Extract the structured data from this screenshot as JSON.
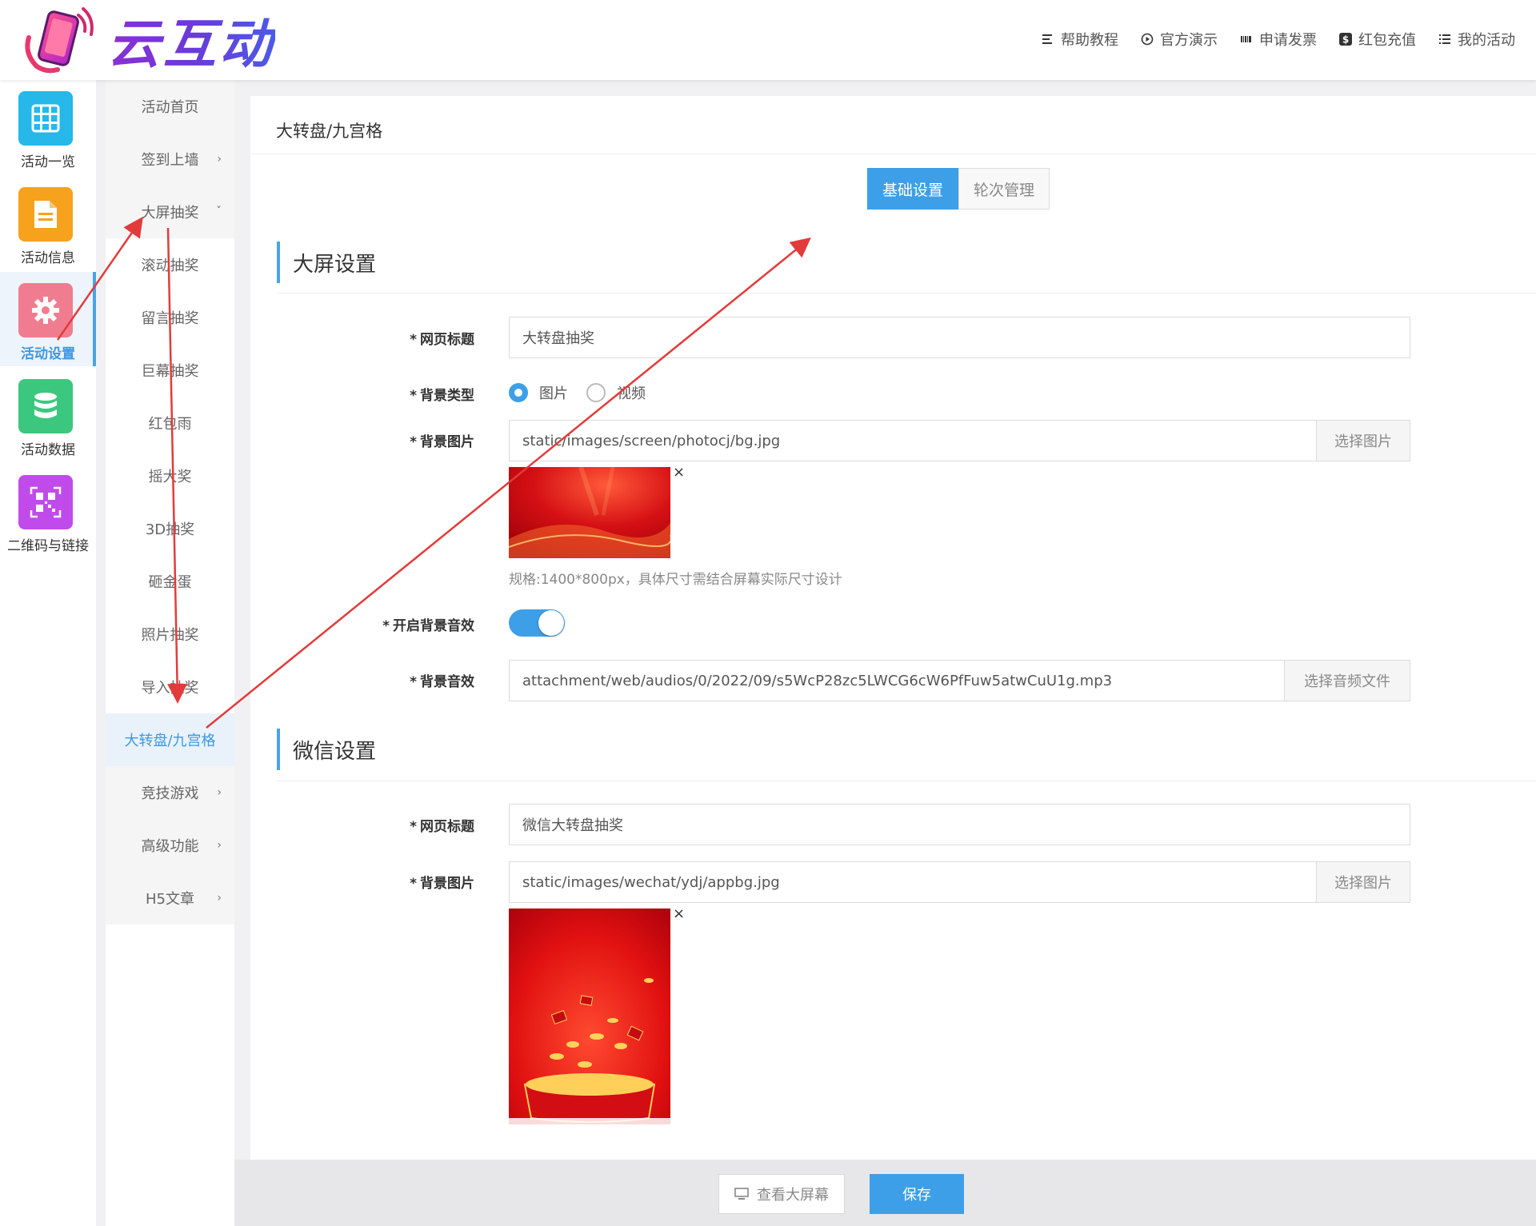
{
  "header": {
    "logo_text": "云互动",
    "nav": [
      {
        "icon": "list-icon",
        "label": "帮助教程"
      },
      {
        "icon": "play-circle-icon",
        "label": "官方演示"
      },
      {
        "icon": "barcode-icon",
        "label": "申请发票"
      },
      {
        "icon": "dollar-icon",
        "label": "红包充值"
      },
      {
        "icon": "menu-icon",
        "label": "我的活动"
      }
    ]
  },
  "rail": {
    "items": [
      {
        "label": "活动一览",
        "icon": "grid-icon",
        "color": "#25b8e8"
      },
      {
        "label": "活动信息",
        "icon": "document-icon",
        "color": "#f6a21d"
      },
      {
        "label": "活动设置",
        "icon": "gear-icon",
        "color": "#f07d8f"
      },
      {
        "label": "活动数据",
        "icon": "database-icon",
        "color": "#3cc77e"
      },
      {
        "label": "二维码与链接",
        "icon": "qrcode-icon",
        "color": "#c14bea"
      }
    ]
  },
  "subnav": {
    "items": [
      {
        "label": "活动首页"
      },
      {
        "label": "签到上墙"
      },
      {
        "label": "大屏抽奖"
      },
      {
        "label": "滚动抽奖"
      },
      {
        "label": "留言抽奖"
      },
      {
        "label": "巨幕抽奖"
      },
      {
        "label": "红包雨"
      },
      {
        "label": "摇大奖"
      },
      {
        "label": "3D抽奖"
      },
      {
        "label": "砸金蛋"
      },
      {
        "label": "照片抽奖"
      },
      {
        "label": "导入抽奖"
      },
      {
        "label": "大转盘/九宫格"
      },
      {
        "label": "竞技游戏"
      },
      {
        "label": "高级功能"
      },
      {
        "label": "H5文章"
      }
    ]
  },
  "main": {
    "title": "大转盘/九宫格",
    "tabs": [
      "基础设置",
      "轮次管理"
    ],
    "screen_section": {
      "title": "大屏设置",
      "page_title_label": "网页标题",
      "page_title_value": "大转盘抽奖",
      "bg_type_label": "背景类型",
      "bg_type_options": [
        "图片",
        "视频"
      ],
      "bg_image_label": "背景图片",
      "bg_image_value": "static/images/screen/photocj/bg.jpg",
      "choose_image": "选择图片",
      "spec_hint": "规格:1400*800px，具体尺寸需结合屏幕实际尺寸设计",
      "bg_sound_toggle_label": "开启背景音效",
      "bg_sound_label": "背景音效",
      "bg_sound_value": "attachment/web/audios/0/2022/09/s5WcP28zc5LWCG6cW6PfFuw5atwCuU1g.mp3",
      "choose_audio": "选择音频文件"
    },
    "wechat_section": {
      "title": "微信设置",
      "page_title_label": "网页标题",
      "page_title_value": "微信大转盘抽奖",
      "bg_image_label": "背景图片",
      "bg_image_value": "static/images/wechat/ydj/appbg.jpg",
      "choose_image": "选择图片"
    }
  },
  "footer": {
    "view_label": "查看大屏幕",
    "save_label": "保存"
  },
  "required_mark": "*",
  "close_mark": "×",
  "chevron_right": "›",
  "chevron_down": "ˇ"
}
